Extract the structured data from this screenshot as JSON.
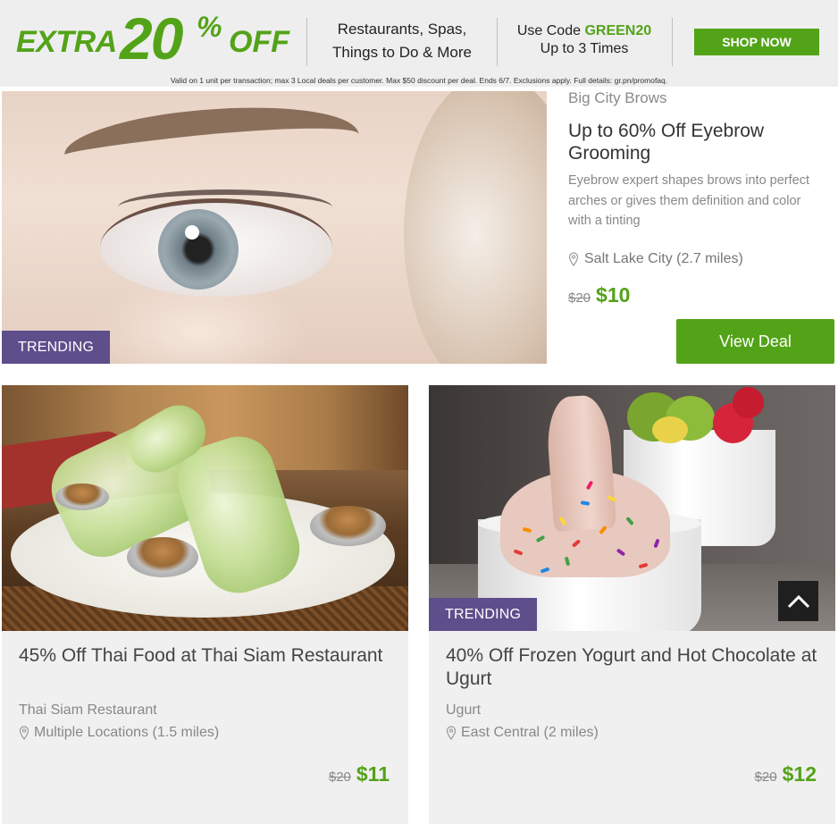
{
  "promo": {
    "extra": "EXTRA",
    "amount": "20",
    "percent": "%",
    "off": "OFF",
    "categories_line1": "Restaurants, Spas,",
    "categories_line2": "Things to Do & More",
    "code_prefix": "Use Code",
    "code": "GREEN20",
    "code_limit": "Up to 3 Times",
    "shop_label": "SHOP NOW",
    "fine_print": "Valid on 1 unit per transaction; max 3 Local deals per customer. Max $50 discount per deal. Ends 6/7. Exclusions apply. Full details: gr.pn/promofaq."
  },
  "featured": {
    "badge": "TRENDING",
    "merchant": "Big City Brows",
    "title": "Up to 60% Off Eyebrow Grooming",
    "description": "Eyebrow expert shapes brows into perfect arches or gives them definition and color with a tinting",
    "location": "Salt Lake City (2.7 miles)",
    "old_price": "$20",
    "new_price": "$10",
    "cta": "View Deal"
  },
  "cards": [
    {
      "title": "45% Off Thai Food at Thai Siam Restaurant",
      "merchant": "Thai Siam Restaurant",
      "location": "Multiple Locations (1.5 miles)",
      "old_price": "$20",
      "new_price": "$11"
    },
    {
      "badge": "TRENDING",
      "title": "40% Off Frozen Yogurt and Hot Chocolate at Ugurt",
      "merchant": "Ugurt",
      "location": "East Central (2 miles)",
      "old_price": "$20",
      "new_price": "$12"
    }
  ],
  "colors": {
    "brand_green": "#53a318",
    "trending_purple": "#5f4e8c",
    "banner_bg": "#eeeeee",
    "card_bg": "#f0f0f0"
  },
  "icons": {
    "location": "map-pin-icon",
    "scroll": "chevron-up-icon"
  }
}
